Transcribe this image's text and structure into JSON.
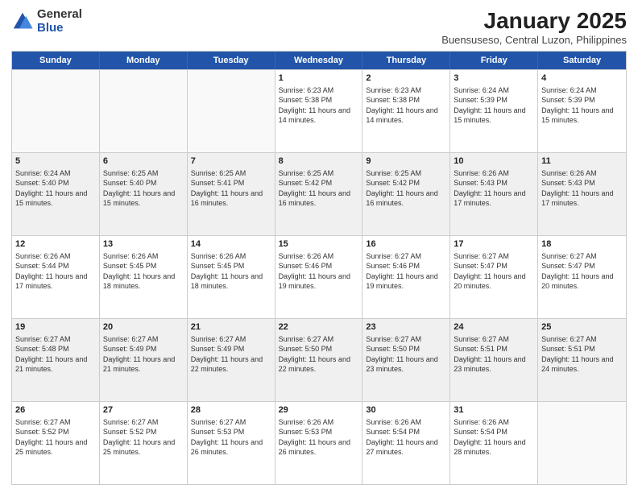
{
  "logo": {
    "general": "General",
    "blue": "Blue"
  },
  "title": "January 2025",
  "location": "Buensuseso, Central Luzon, Philippines",
  "days": [
    "Sunday",
    "Monday",
    "Tuesday",
    "Wednesday",
    "Thursday",
    "Friday",
    "Saturday"
  ],
  "weeks": [
    [
      {
        "day": "",
        "lines": []
      },
      {
        "day": "",
        "lines": []
      },
      {
        "day": "",
        "lines": []
      },
      {
        "day": "1",
        "lines": [
          "Sunrise: 6:23 AM",
          "Sunset: 5:38 PM",
          "Daylight: 11 hours and 14 minutes."
        ]
      },
      {
        "day": "2",
        "lines": [
          "Sunrise: 6:23 AM",
          "Sunset: 5:38 PM",
          "Daylight: 11 hours and 14 minutes."
        ]
      },
      {
        "day": "3",
        "lines": [
          "Sunrise: 6:24 AM",
          "Sunset: 5:39 PM",
          "Daylight: 11 hours and 15 minutes."
        ]
      },
      {
        "day": "4",
        "lines": [
          "Sunrise: 6:24 AM",
          "Sunset: 5:39 PM",
          "Daylight: 11 hours and 15 minutes."
        ]
      }
    ],
    [
      {
        "day": "5",
        "lines": [
          "Sunrise: 6:24 AM",
          "Sunset: 5:40 PM",
          "Daylight: 11 hours and 15 minutes."
        ]
      },
      {
        "day": "6",
        "lines": [
          "Sunrise: 6:25 AM",
          "Sunset: 5:40 PM",
          "Daylight: 11 hours and 15 minutes."
        ]
      },
      {
        "day": "7",
        "lines": [
          "Sunrise: 6:25 AM",
          "Sunset: 5:41 PM",
          "Daylight: 11 hours and 16 minutes."
        ]
      },
      {
        "day": "8",
        "lines": [
          "Sunrise: 6:25 AM",
          "Sunset: 5:42 PM",
          "Daylight: 11 hours and 16 minutes."
        ]
      },
      {
        "day": "9",
        "lines": [
          "Sunrise: 6:25 AM",
          "Sunset: 5:42 PM",
          "Daylight: 11 hours and 16 minutes."
        ]
      },
      {
        "day": "10",
        "lines": [
          "Sunrise: 6:26 AM",
          "Sunset: 5:43 PM",
          "Daylight: 11 hours and 17 minutes."
        ]
      },
      {
        "day": "11",
        "lines": [
          "Sunrise: 6:26 AM",
          "Sunset: 5:43 PM",
          "Daylight: 11 hours and 17 minutes."
        ]
      }
    ],
    [
      {
        "day": "12",
        "lines": [
          "Sunrise: 6:26 AM",
          "Sunset: 5:44 PM",
          "Daylight: 11 hours and 17 minutes."
        ]
      },
      {
        "day": "13",
        "lines": [
          "Sunrise: 6:26 AM",
          "Sunset: 5:45 PM",
          "Daylight: 11 hours and 18 minutes."
        ]
      },
      {
        "day": "14",
        "lines": [
          "Sunrise: 6:26 AM",
          "Sunset: 5:45 PM",
          "Daylight: 11 hours and 18 minutes."
        ]
      },
      {
        "day": "15",
        "lines": [
          "Sunrise: 6:26 AM",
          "Sunset: 5:46 PM",
          "Daylight: 11 hours and 19 minutes."
        ]
      },
      {
        "day": "16",
        "lines": [
          "Sunrise: 6:27 AM",
          "Sunset: 5:46 PM",
          "Daylight: 11 hours and 19 minutes."
        ]
      },
      {
        "day": "17",
        "lines": [
          "Sunrise: 6:27 AM",
          "Sunset: 5:47 PM",
          "Daylight: 11 hours and 20 minutes."
        ]
      },
      {
        "day": "18",
        "lines": [
          "Sunrise: 6:27 AM",
          "Sunset: 5:47 PM",
          "Daylight: 11 hours and 20 minutes."
        ]
      }
    ],
    [
      {
        "day": "19",
        "lines": [
          "Sunrise: 6:27 AM",
          "Sunset: 5:48 PM",
          "Daylight: 11 hours and 21 minutes."
        ]
      },
      {
        "day": "20",
        "lines": [
          "Sunrise: 6:27 AM",
          "Sunset: 5:49 PM",
          "Daylight: 11 hours and 21 minutes."
        ]
      },
      {
        "day": "21",
        "lines": [
          "Sunrise: 6:27 AM",
          "Sunset: 5:49 PM",
          "Daylight: 11 hours and 22 minutes."
        ]
      },
      {
        "day": "22",
        "lines": [
          "Sunrise: 6:27 AM",
          "Sunset: 5:50 PM",
          "Daylight: 11 hours and 22 minutes."
        ]
      },
      {
        "day": "23",
        "lines": [
          "Sunrise: 6:27 AM",
          "Sunset: 5:50 PM",
          "Daylight: 11 hours and 23 minutes."
        ]
      },
      {
        "day": "24",
        "lines": [
          "Sunrise: 6:27 AM",
          "Sunset: 5:51 PM",
          "Daylight: 11 hours and 23 minutes."
        ]
      },
      {
        "day": "25",
        "lines": [
          "Sunrise: 6:27 AM",
          "Sunset: 5:51 PM",
          "Daylight: 11 hours and 24 minutes."
        ]
      }
    ],
    [
      {
        "day": "26",
        "lines": [
          "Sunrise: 6:27 AM",
          "Sunset: 5:52 PM",
          "Daylight: 11 hours and 25 minutes."
        ]
      },
      {
        "day": "27",
        "lines": [
          "Sunrise: 6:27 AM",
          "Sunset: 5:52 PM",
          "Daylight: 11 hours and 25 minutes."
        ]
      },
      {
        "day": "28",
        "lines": [
          "Sunrise: 6:27 AM",
          "Sunset: 5:53 PM",
          "Daylight: 11 hours and 26 minutes."
        ]
      },
      {
        "day": "29",
        "lines": [
          "Sunrise: 6:26 AM",
          "Sunset: 5:53 PM",
          "Daylight: 11 hours and 26 minutes."
        ]
      },
      {
        "day": "30",
        "lines": [
          "Sunrise: 6:26 AM",
          "Sunset: 5:54 PM",
          "Daylight: 11 hours and 27 minutes."
        ]
      },
      {
        "day": "31",
        "lines": [
          "Sunrise: 6:26 AM",
          "Sunset: 5:54 PM",
          "Daylight: 11 hours and 28 minutes."
        ]
      },
      {
        "day": "",
        "lines": []
      }
    ]
  ]
}
